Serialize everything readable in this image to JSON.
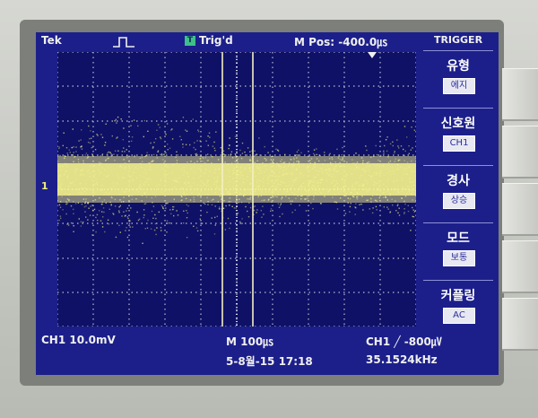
{
  "header": {
    "brand": "Tek",
    "trigger_status": "Trig'd",
    "trigger_icon": "T",
    "position_readout": "M Pos: -400.0㎲"
  },
  "menu": {
    "title": "TRIGGER",
    "items": [
      {
        "label": "유형",
        "value": "에지"
      },
      {
        "label": "신호원",
        "value": "CH1"
      },
      {
        "label": "경사",
        "value": "상승"
      },
      {
        "label": "모드",
        "value": "보통"
      },
      {
        "label": "커플링",
        "value": "AC"
      }
    ]
  },
  "status": {
    "channel_scale": "CH1  10.0mV",
    "time_scale": "M 100㎲",
    "trigger_readout": "CH1 ╱ -800㎶",
    "date_time": "5-8월-15  17:18",
    "frequency": "35.1524kHz"
  },
  "channel_marker": "1",
  "colors": {
    "screen_bg": "#1c1f8a",
    "trace": "#f4f28c",
    "grid": "#d8d8e8"
  }
}
